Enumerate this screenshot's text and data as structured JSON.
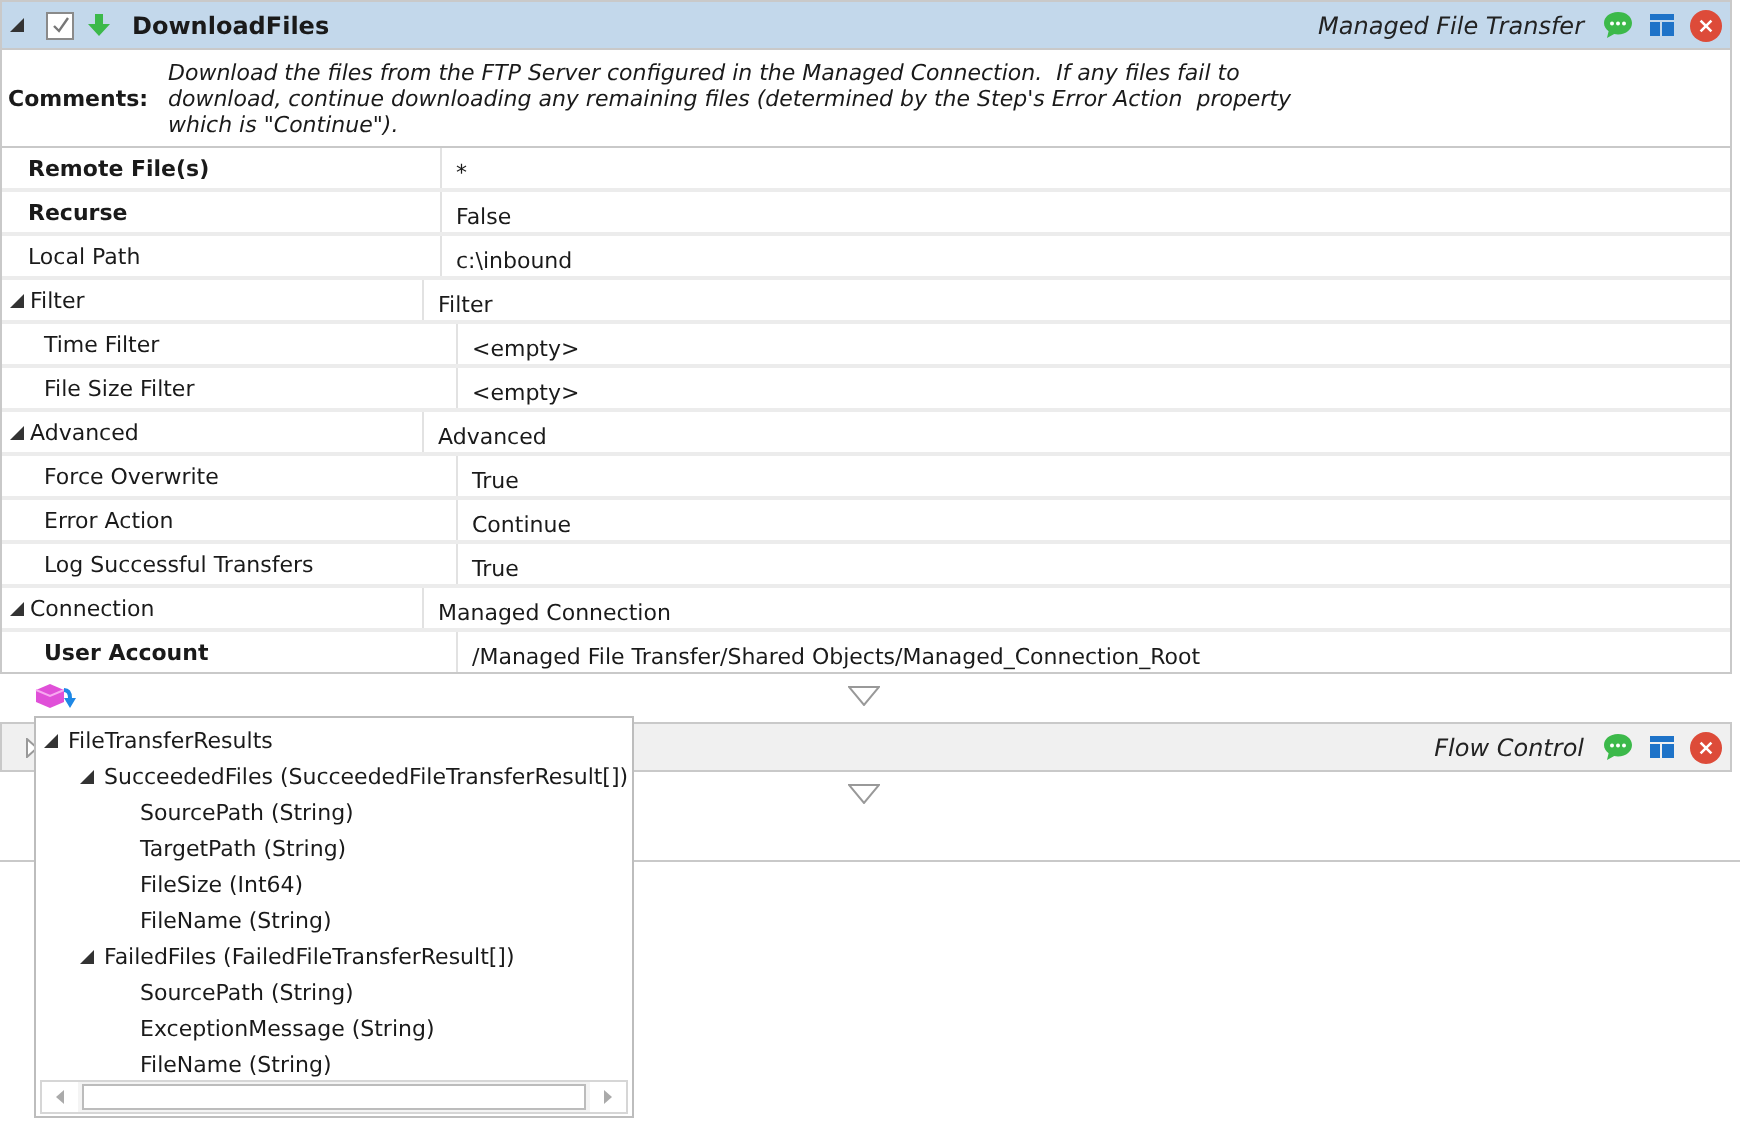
{
  "steps": [
    {
      "expanded": true,
      "enabled": true,
      "name": "DownloadFiles",
      "category": "Managed File Transfer",
      "comments_label": "Comments:",
      "comments": "Download the files from the FTP Server configured in the Managed Connection.  If any files fail to download, continue downloading any remaining files (determined by the Step's Error Action  property which is \"Continue\").",
      "properties": [
        {
          "name": "Remote File(s)",
          "value": "*",
          "required": true
        },
        {
          "name": "Recurse",
          "value": "False",
          "required": true
        },
        {
          "name": "Local Path",
          "value": "c:\\inbound",
          "required": false
        },
        {
          "name": "Filter",
          "value": "Filter",
          "required": false,
          "expanded": true,
          "children": [
            {
              "name": "Time Filter",
              "value": "<empty>",
              "required": false
            },
            {
              "name": "File Size Filter",
              "value": "<empty>",
              "required": false
            }
          ]
        },
        {
          "name": "Advanced",
          "value": "Advanced",
          "required": false,
          "expanded": true,
          "children": [
            {
              "name": "Force Overwrite",
              "value": "True",
              "required": false
            },
            {
              "name": "Error Action",
              "value": "Continue",
              "required": false
            },
            {
              "name": "Log Successful Transfers",
              "value": "True",
              "required": false
            }
          ]
        },
        {
          "name": "Connection",
          "value": "Managed Connection",
          "required": false,
          "expanded": true,
          "children": [
            {
              "name": "User Account",
              "value": "/Managed File Transfer/Shared Objects/Managed_Connection_Root",
              "required": true
            }
          ]
        }
      ]
    },
    {
      "expanded": false,
      "category": "Flow Control"
    }
  ],
  "output_popup": {
    "tree": [
      {
        "label": "FileTransferResults",
        "expanded": true,
        "children": [
          {
            "label": "SucceededFiles (SucceededFileTransferResult[])",
            "expanded": true,
            "children": [
              {
                "label": "SourcePath (String)"
              },
              {
                "label": "TargetPath (String)"
              },
              {
                "label": "FileSize (Int64)"
              },
              {
                "label": "FileName (String)"
              }
            ]
          },
          {
            "label": "FailedFiles (FailedFileTransferResult[])",
            "expanded": true,
            "children": [
              {
                "label": "SourcePath (String)"
              },
              {
                "label": "ExceptionMessage (String)"
              },
              {
                "label": "FileName (String)"
              }
            ]
          }
        ]
      }
    ]
  }
}
